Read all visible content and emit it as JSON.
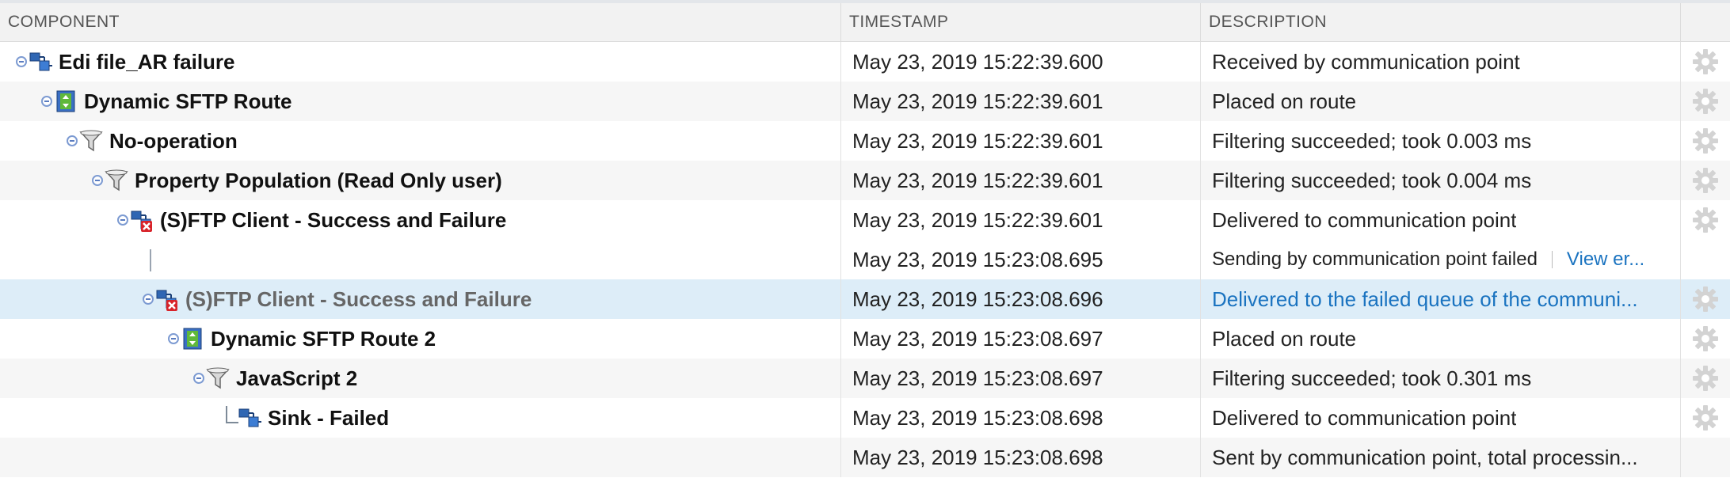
{
  "header": {
    "component": "COMPONENT",
    "timestamp": "TIMESTAMP",
    "description": "DESCRIPTION"
  },
  "rows": [
    {
      "component": "Edi file_AR failure",
      "icon": "communication-point-icon",
      "timestamp": "May 23, 2019 15:22:39.600",
      "description": "Received by communication point"
    },
    {
      "component": "Dynamic SFTP Route",
      "icon": "route-icon",
      "timestamp": "May 23, 2019 15:22:39.601",
      "description": "Placed on route"
    },
    {
      "component": "No-operation",
      "icon": "filter-icon",
      "timestamp": "May 23, 2019 15:22:39.601",
      "description": "Filtering succeeded; took 0.003 ms"
    },
    {
      "component": "Property Population (Read Only user)",
      "icon": "filter-icon",
      "timestamp": "May 23, 2019 15:22:39.601",
      "description": "Filtering succeeded; took 0.004 ms"
    },
    {
      "component": "(S)FTP Client - Success and Failure",
      "icon": "communication-point-error-icon",
      "timestamp": "May 23, 2019 15:22:39.601",
      "description": "Delivered to communication point"
    },
    {
      "component": "",
      "icon": "",
      "timestamp": "May 23, 2019 15:23:08.695",
      "description": "Sending by communication point failed",
      "link": "View er..."
    },
    {
      "component": "(S)FTP Client - Success and Failure",
      "icon": "communication-point-error-icon",
      "timestamp": "May 23, 2019 15:23:08.696",
      "description": "Delivered to the failed queue of the communi..."
    },
    {
      "component": "Dynamic SFTP Route 2",
      "icon": "route-icon",
      "timestamp": "May 23, 2019 15:23:08.697",
      "description": "Placed on route"
    },
    {
      "component": "JavaScript 2",
      "icon": "filter-icon",
      "timestamp": "May 23, 2019 15:23:08.697",
      "description": "Filtering succeeded; took 0.301 ms"
    },
    {
      "component": "Sink - Failed",
      "icon": "communication-point-icon",
      "timestamp": "May 23, 2019 15:23:08.698",
      "description": "Delivered to communication point"
    },
    {
      "component": "",
      "icon": "",
      "timestamp": "May 23, 2019 15:23:08.698",
      "description": "Sent by communication point, total processin..."
    }
  ],
  "colors": {
    "selected_row": "#ddedf8",
    "link": "#1a73c0",
    "error_badge": "#d8232a",
    "route_green": "#5fb83a"
  }
}
